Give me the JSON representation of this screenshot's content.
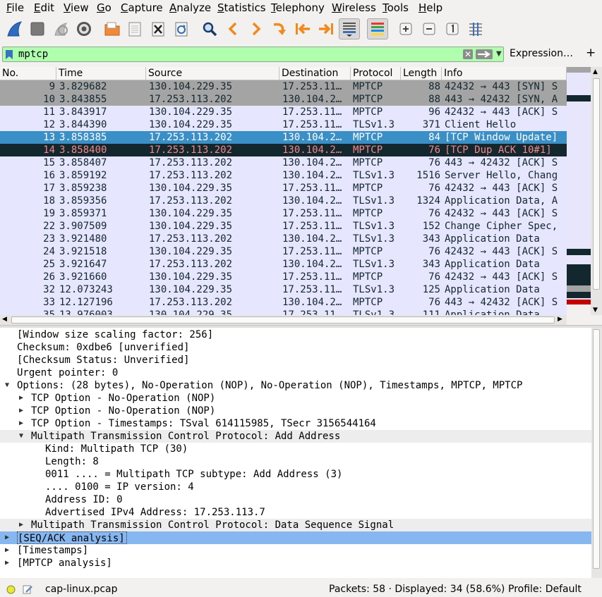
{
  "menu": [
    "File",
    "Edit",
    "View",
    "Go",
    "Capture",
    "Analyze",
    "Statistics",
    "Telephony",
    "Wireless",
    "Tools",
    "Help"
  ],
  "toolbar": {
    "icons": [
      "shark-fin-start-icon",
      "stop-square-icon",
      "restart-fin-icon",
      "gear-options-icon",
      "open-folder-icon",
      "save-file-icon",
      "close-file-icon",
      "reload-file-icon",
      "magnifier-find-icon",
      "go-back-icon",
      "go-forward-icon",
      "go-to-packet-icon",
      "first-packet-icon",
      "last-packet-icon",
      "autoscroll-icon",
      "colorize-icon",
      "zoom-in-icon",
      "zoom-out-icon",
      "zoom-normal-icon",
      "resize-columns-icon"
    ]
  },
  "filter": {
    "value": "mptcp",
    "expression_label": "Expression…",
    "add_label": "+"
  },
  "columns": [
    "No.",
    "Time",
    "Source",
    "Destination",
    "Protocol",
    "Length",
    "Info"
  ],
  "packets": [
    {
      "no": "9",
      "time": "3.829682",
      "src": "130.104.229.35",
      "dst": "17.253.11…",
      "proto": "MPTCP",
      "len": "88",
      "info": "42432 → 443 [SYN] S",
      "bg": "#a4a4a4",
      "fg": "#12272e"
    },
    {
      "no": "10",
      "time": "3.843855",
      "src": "17.253.113.202",
      "dst": "130.104.2…",
      "proto": "MPTCP",
      "len": "88",
      "info": "443 → 42432 [SYN, A",
      "bg": "#a4a4a4",
      "fg": "#12272e"
    },
    {
      "no": "11",
      "time": "3.843917",
      "src": "130.104.229.35",
      "dst": "17.253.11…",
      "proto": "MPTCP",
      "len": "96",
      "info": "42432 → 443 [ACK] S",
      "bg": "#e7e6ff",
      "fg": "#12272e"
    },
    {
      "no": "12",
      "time": "3.844390",
      "src": "130.104.229.35",
      "dst": "17.253.11…",
      "proto": "TLSv1.3",
      "len": "371",
      "info": "Client Hello",
      "bg": "#e7e6ff",
      "fg": "#12272e"
    },
    {
      "no": "13",
      "time": "3.858385",
      "src": "17.253.113.202",
      "dst": "130.104.2…",
      "proto": "MPTCP",
      "len": "84",
      "info": "[TCP Window Update]",
      "bg": "#3a8fc6",
      "fg": "#ffffff"
    },
    {
      "no": "14",
      "time": "3.858400",
      "src": "17.253.113.202",
      "dst": "130.104.2…",
      "proto": "MPTCP",
      "len": "76",
      "info": "[TCP Dup ACK 10#1]",
      "bg": "#12272e",
      "fg": "#f78787"
    },
    {
      "no": "15",
      "time": "3.858407",
      "src": "17.253.113.202",
      "dst": "130.104.2…",
      "proto": "MPTCP",
      "len": "76",
      "info": "443 → 42432 [ACK] S",
      "bg": "#e7e6ff",
      "fg": "#12272e"
    },
    {
      "no": "16",
      "time": "3.859192",
      "src": "17.253.113.202",
      "dst": "130.104.2…",
      "proto": "TLSv1.3",
      "len": "1516",
      "info": "Server Hello, Chang",
      "bg": "#e7e6ff",
      "fg": "#12272e"
    },
    {
      "no": "17",
      "time": "3.859238",
      "src": "130.104.229.35",
      "dst": "17.253.11…",
      "proto": "MPTCP",
      "len": "76",
      "info": "42432 → 443 [ACK] S",
      "bg": "#e7e6ff",
      "fg": "#12272e"
    },
    {
      "no": "18",
      "time": "3.859356",
      "src": "17.253.113.202",
      "dst": "130.104.2…",
      "proto": "TLSv1.3",
      "len": "1324",
      "info": "Application Data, A",
      "bg": "#e7e6ff",
      "fg": "#12272e"
    },
    {
      "no": "19",
      "time": "3.859371",
      "src": "130.104.229.35",
      "dst": "17.253.11…",
      "proto": "MPTCP",
      "len": "76",
      "info": "42432 → 443 [ACK] S",
      "bg": "#e7e6ff",
      "fg": "#12272e"
    },
    {
      "no": "22",
      "time": "3.907509",
      "src": "130.104.229.35",
      "dst": "17.253.11…",
      "proto": "TLSv1.3",
      "len": "152",
      "info": "Change Cipher Spec,",
      "bg": "#e7e6ff",
      "fg": "#12272e"
    },
    {
      "no": "23",
      "time": "3.921480",
      "src": "17.253.113.202",
      "dst": "130.104.2…",
      "proto": "TLSv1.3",
      "len": "343",
      "info": "Application Data",
      "bg": "#e7e6ff",
      "fg": "#12272e"
    },
    {
      "no": "24",
      "time": "3.921518",
      "src": "130.104.229.35",
      "dst": "17.253.11…",
      "proto": "MPTCP",
      "len": "76",
      "info": "42432 → 443 [ACK] S",
      "bg": "#e7e6ff",
      "fg": "#12272e"
    },
    {
      "no": "25",
      "time": "3.921647",
      "src": "17.253.113.202",
      "dst": "130.104.2…",
      "proto": "TLSv1.3",
      "len": "343",
      "info": "Application Data",
      "bg": "#e7e6ff",
      "fg": "#12272e"
    },
    {
      "no": "26",
      "time": "3.921660",
      "src": "130.104.229.35",
      "dst": "17.253.11…",
      "proto": "MPTCP",
      "len": "76",
      "info": "42432 → 443 [ACK] S",
      "bg": "#e7e6ff",
      "fg": "#12272e"
    },
    {
      "no": "32",
      "time": "12.073243",
      "src": "130.104.229.35",
      "dst": "17.253.11…",
      "proto": "TLSv1.3",
      "len": "125",
      "info": "Application Data",
      "bg": "#e7e6ff",
      "fg": "#12272e"
    },
    {
      "no": "33",
      "time": "12.127196",
      "src": "17.253.113.202",
      "dst": "130.104.2…",
      "proto": "MPTCP",
      "len": "76",
      "info": "443 → 42432 [ACK] S",
      "bg": "#e7e6ff",
      "fg": "#12272e"
    },
    {
      "no": "35",
      "time": "13.976003",
      "src": "130.104.229.35",
      "dst": "17.253.11…",
      "proto": "TLSv1.3",
      "len": "111",
      "info": "Application Data",
      "bg": "#e7e6ff",
      "fg": "#12272e"
    }
  ],
  "details": [
    {
      "depth": 1,
      "arrow": "none",
      "text": "[Window size scaling factor: 256]"
    },
    {
      "depth": 1,
      "arrow": "none",
      "text": "Checksum: 0xdbe6 [unverified]"
    },
    {
      "depth": 1,
      "arrow": "none",
      "text": "[Checksum Status: Unverified]"
    },
    {
      "depth": 1,
      "arrow": "none",
      "text": "Urgent pointer: 0"
    },
    {
      "depth": 1,
      "arrow": "down",
      "text": "Options: (28 bytes), No-Operation (NOP), No-Operation (NOP), Timestamps, MPTCP, MPTCP"
    },
    {
      "depth": 2,
      "arrow": "right",
      "text": "TCP Option - No-Operation (NOP)"
    },
    {
      "depth": 2,
      "arrow": "right",
      "text": "TCP Option - No-Operation (NOP)"
    },
    {
      "depth": 2,
      "arrow": "right",
      "text": "TCP Option - Timestamps: TSval 614115985, TSecr 3156544164"
    },
    {
      "depth": 2,
      "arrow": "down",
      "text": "Multipath Transmission Control Protocol: Add Address",
      "band": true
    },
    {
      "depth": 3,
      "arrow": "none",
      "text": "Kind: Multipath TCP (30)"
    },
    {
      "depth": 3,
      "arrow": "none",
      "text": "Length: 8"
    },
    {
      "depth": 3,
      "arrow": "none",
      "text": "0011 .... = Multipath TCP subtype: Add Address (3)"
    },
    {
      "depth": 3,
      "arrow": "none",
      "text": ".... 0100 = IP version: 4"
    },
    {
      "depth": 3,
      "arrow": "none",
      "text": "Address ID: 0"
    },
    {
      "depth": 3,
      "arrow": "none",
      "text": "Advertised IPv4 Address: 17.253.113.7"
    },
    {
      "depth": 2,
      "arrow": "right",
      "text": "Multipath Transmission Control Protocol: Data Sequence Signal",
      "band": true
    },
    {
      "depth": 1,
      "arrow": "right",
      "text": "[SEQ/ACK analysis]",
      "selected": true
    },
    {
      "depth": 1,
      "arrow": "right",
      "text": "[Timestamps]"
    },
    {
      "depth": 1,
      "arrow": "right",
      "text": "[MPTCP analysis]"
    }
  ],
  "status": {
    "file": "cap-linux.pcap",
    "packets": "Packets: 58 · Displayed: 34 (58.6%)",
    "profile": "Profile: Default"
  },
  "colors": {
    "filter_valid": "#afffaf",
    "selected_row": "#3a8fc6",
    "tcp_dup_ack_bg": "#12272e",
    "tcp_dup_ack_fg": "#f78787",
    "syn_bg": "#a4a4a4",
    "tcp_bg": "#e7e6ff",
    "detail_selected": "#86b7f0"
  }
}
